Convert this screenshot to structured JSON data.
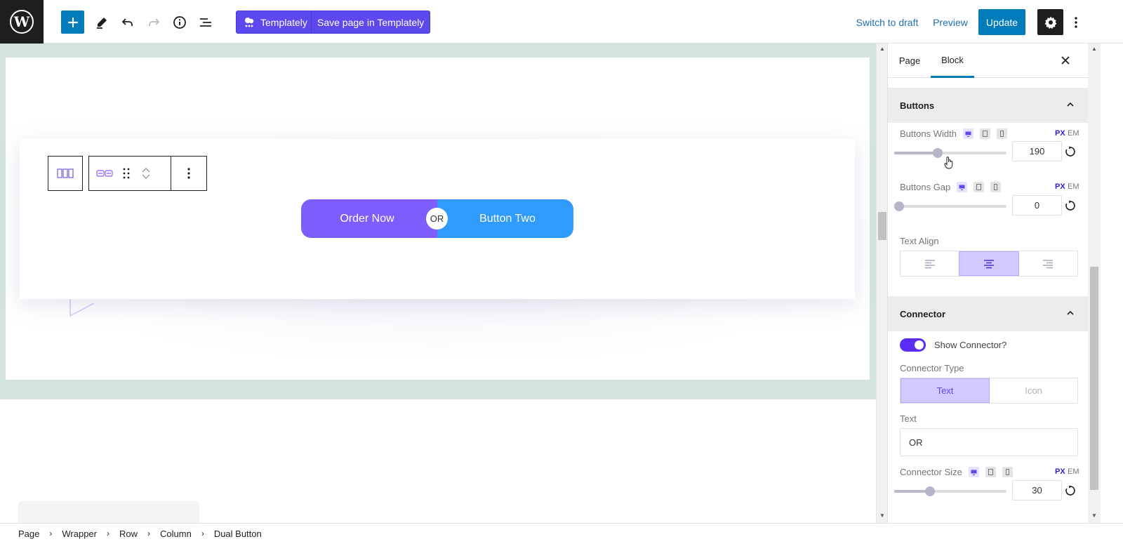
{
  "toolbar": {
    "templately_label": "Templately",
    "save_templately_label": "Save page in Templately",
    "switch_to_draft_label": "Switch to draft",
    "preview_label": "Preview",
    "update_label": "Update"
  },
  "canvas": {
    "button_one_text": "Order Now",
    "button_two_text": "Button Two",
    "connector_text": "OR"
  },
  "sidebar": {
    "tabs": [
      {
        "label": "Page",
        "active": false
      },
      {
        "label": "Block",
        "active": true
      }
    ],
    "buttons_panel": {
      "title": "Buttons",
      "width_label": "Buttons Width",
      "width_value": "190",
      "width_fraction": 0.38,
      "gap_label": "Buttons Gap",
      "gap_value": "0",
      "gap_fraction": 0.0,
      "text_align_label": "Text Align",
      "text_align_options": [
        "left",
        "center",
        "right"
      ],
      "text_align_selected": "center",
      "unit_px": "PX",
      "unit_em": "EM"
    },
    "connector_panel": {
      "title": "Connector",
      "show_connector_label": "Show Connector?",
      "show_connector_on": true,
      "type_label": "Connector Type",
      "type_options": [
        "Text",
        "Icon"
      ],
      "type_selected": "Text",
      "text_label": "Text",
      "text_value": "OR",
      "size_label": "Connector Size",
      "size_value": "30",
      "size_fraction": 0.3
    }
  },
  "breadcrumb": [
    "Page",
    "Wrapper",
    "Row",
    "Column",
    "Dual Button"
  ],
  "colors": {
    "wp_blue": "#007cba",
    "templately_purple": "#5b49ee",
    "button_one": "#7d5efc",
    "button_two": "#2f9bfd",
    "canvas_band": "#d4e4dd",
    "toggle_on": "#5b2cf5",
    "active_option": "#d3c8ff"
  }
}
